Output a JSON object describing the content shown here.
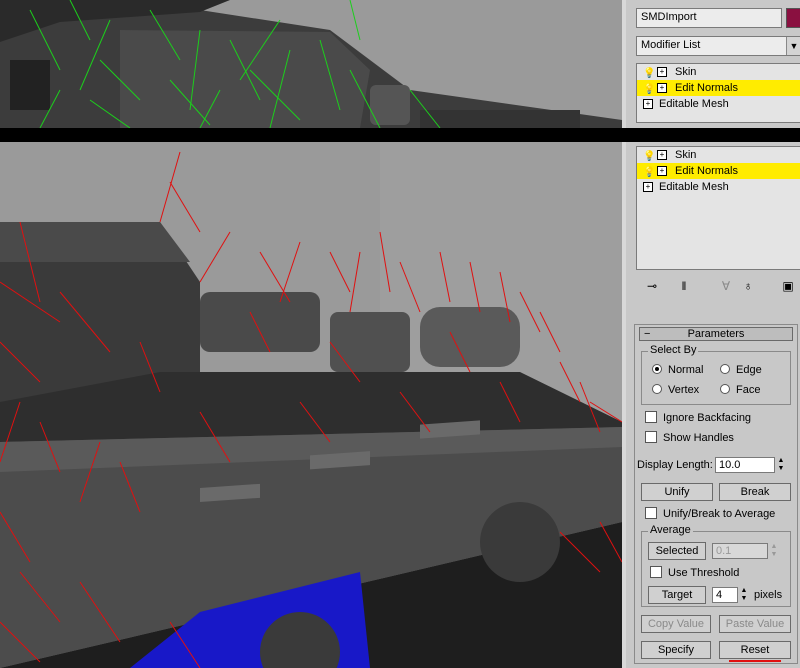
{
  "top_panel": {
    "object_name": "SMDImport",
    "modifier_list": "Modifier List",
    "stack": [
      {
        "label": "Skin",
        "selected": false,
        "icon": "lightbulb-icon"
      },
      {
        "label": "Edit Normals",
        "selected": true,
        "icon": "lightbulb-icon"
      },
      {
        "label": "Editable Mesh",
        "selected": false,
        "icon": ""
      }
    ]
  },
  "main_panel": {
    "stack": [
      {
        "label": "Skin",
        "selected": false,
        "icon": "lightbulb-icon"
      },
      {
        "label": "Edit Normals",
        "selected": true,
        "icon": "lightbulb-icon"
      },
      {
        "label": "Editable Mesh",
        "selected": false,
        "icon": ""
      }
    ],
    "tools": [
      "pin-stack-icon",
      "show-end-result-icon",
      "make-unique-icon",
      "remove-modifier-icon",
      "configure-sets-icon"
    ],
    "parameters": {
      "title": "Parameters",
      "select_by": {
        "title": "Select By",
        "normal": "Normal",
        "edge": "Edge",
        "vertex": "Vertex",
        "face": "Face",
        "selected_option": "Normal"
      },
      "ignore_backfacing": "Ignore Backfacing",
      "show_handles": "Show Handles",
      "display_length_label": "Display Length:",
      "display_length_value": "10.0",
      "unify": "Unify",
      "break": "Break",
      "unify_break_average": "Unify/Break to Average",
      "average": {
        "title": "Average",
        "selected": "Selected",
        "selected_value": "0.1",
        "use_threshold": "Use Threshold",
        "target": "Target",
        "target_value": "4",
        "pixels": "pixels"
      },
      "copy_value": "Copy Value",
      "paste_value": "Paste Value",
      "specify": "Specify",
      "reset": "Reset"
    }
  },
  "colors": {
    "viewport_bg": "#9a9a9a",
    "panel_bg": "#c8c8c8",
    "selected_item": "#ffec00",
    "normals_top": "#20d020",
    "normals_main": "#e01010",
    "swatch": "#8a1040"
  }
}
